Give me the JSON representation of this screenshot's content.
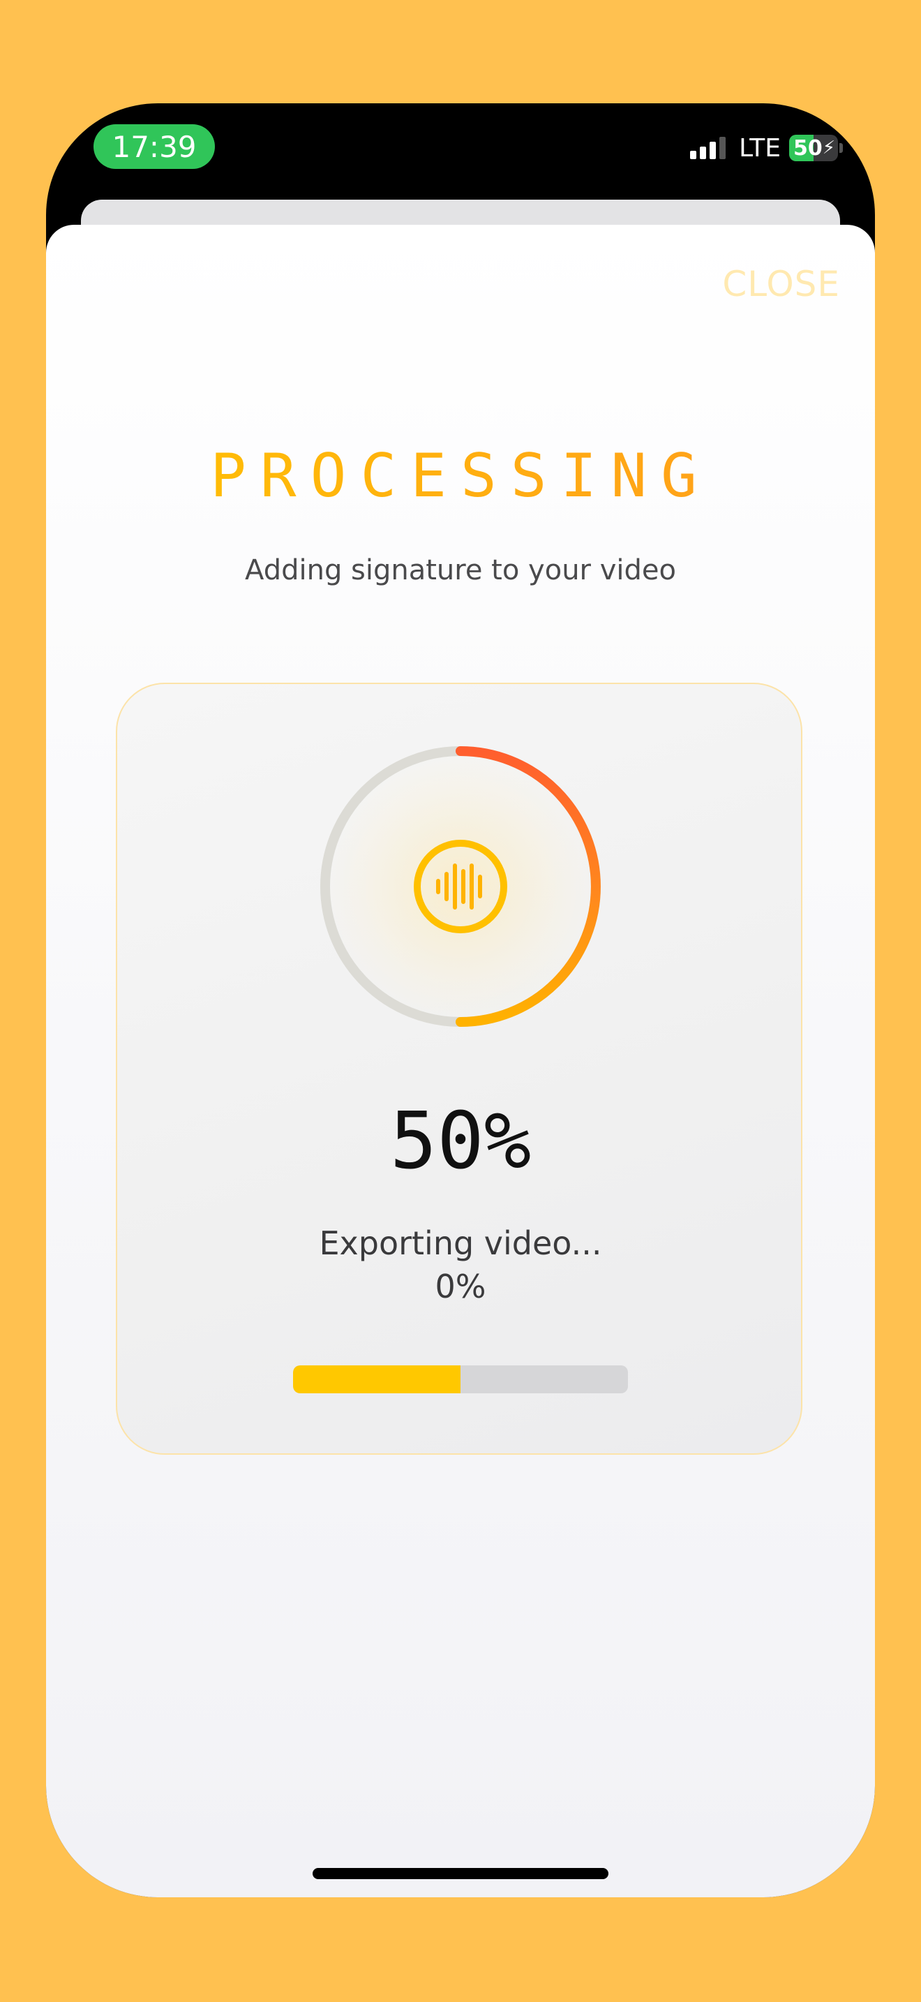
{
  "status_bar": {
    "time": "17:39",
    "network": "LTE",
    "battery": "50",
    "battery_level": 0.5
  },
  "sheet": {
    "close_label": "CLOSE",
    "title": "PROCESSING",
    "subtitle": "Adding signature to your video"
  },
  "progress": {
    "overall_percent_label": "50%",
    "overall_progress": 0.5,
    "step_label": "Exporting video...",
    "step_percent_label": "0%",
    "bar_progress": 0.5
  },
  "colors": {
    "background": "#FFC150",
    "accent_yellow": "#FFC400",
    "accent_orange": "#FF6A2B",
    "status_green": "#30C559"
  },
  "icons": {
    "center_icon": "audio-waveform-icon",
    "signal": "cellular-signal-icon",
    "battery": "battery-charging-icon"
  }
}
